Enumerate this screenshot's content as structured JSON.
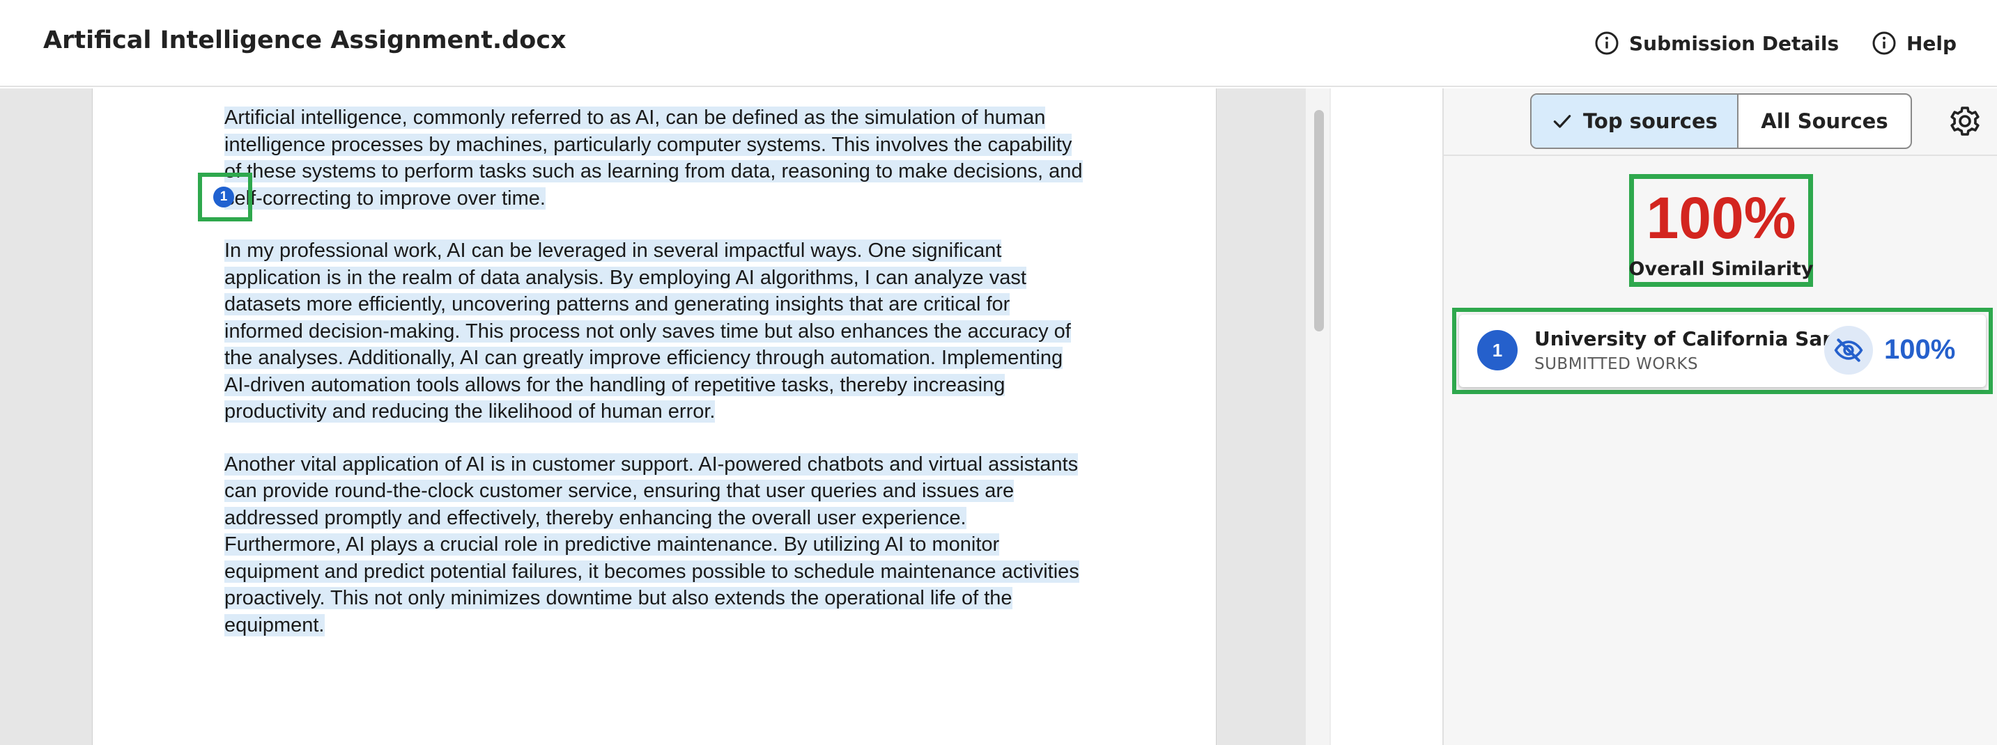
{
  "header": {
    "title": "Artifical Intelligence Assignment.docx",
    "submission_details": "Submission Details",
    "help": "Help"
  },
  "document": {
    "match_marker": "1",
    "paragraphs": [
      "Artificial intelligence, commonly referred to as AI, can be defined as the simulation of human intelligence processes by machines, particularly computer systems. This involves the capability of these systems to perform tasks such as learning from data, reasoning to make decisions, and self-correcting to improve over time.",
      "In my professional work, AI can be leveraged in several impactful ways. One significant application is in the realm of data analysis. By employing AI algorithms, I can analyze vast datasets more efficiently, uncovering patterns and generating insights that are critical for informed decision-making. This process not only saves time but also enhances the accuracy of the analyses. Additionally, AI can greatly improve efficiency through automation. Implementing AI-driven automation tools allows for the handling of repetitive tasks, thereby increasing productivity and reducing the likelihood of human error.",
      "Another vital application of AI is in customer support. AI-powered chatbots and virtual assistants can provide round-the-clock customer service, ensuring that user queries and issues are addressed promptly and effectively, thereby enhancing the overall user experience. Furthermore, AI plays a crucial role in predictive maintenance. By utilizing AI to monitor equipment and predict potential failures, it becomes possible to schedule maintenance activities proactively. This not only minimizes downtime but also extends the operational life of the equipment."
    ]
  },
  "panel": {
    "tabs": {
      "top_sources": "Top sources",
      "all_sources": "All Sources"
    },
    "similarity": {
      "value": "100%",
      "label": "Overall Similarity"
    },
    "sources": [
      {
        "number": "1",
        "name": "University of California San Diego",
        "type": "SUBMITTED WORKS",
        "percent": "100%"
      }
    ]
  },
  "colors": {
    "highlight": "#dcebf8",
    "similarity": "#d3251f",
    "accent_blue": "#2560cc",
    "annotation_green": "#2ea84d"
  }
}
